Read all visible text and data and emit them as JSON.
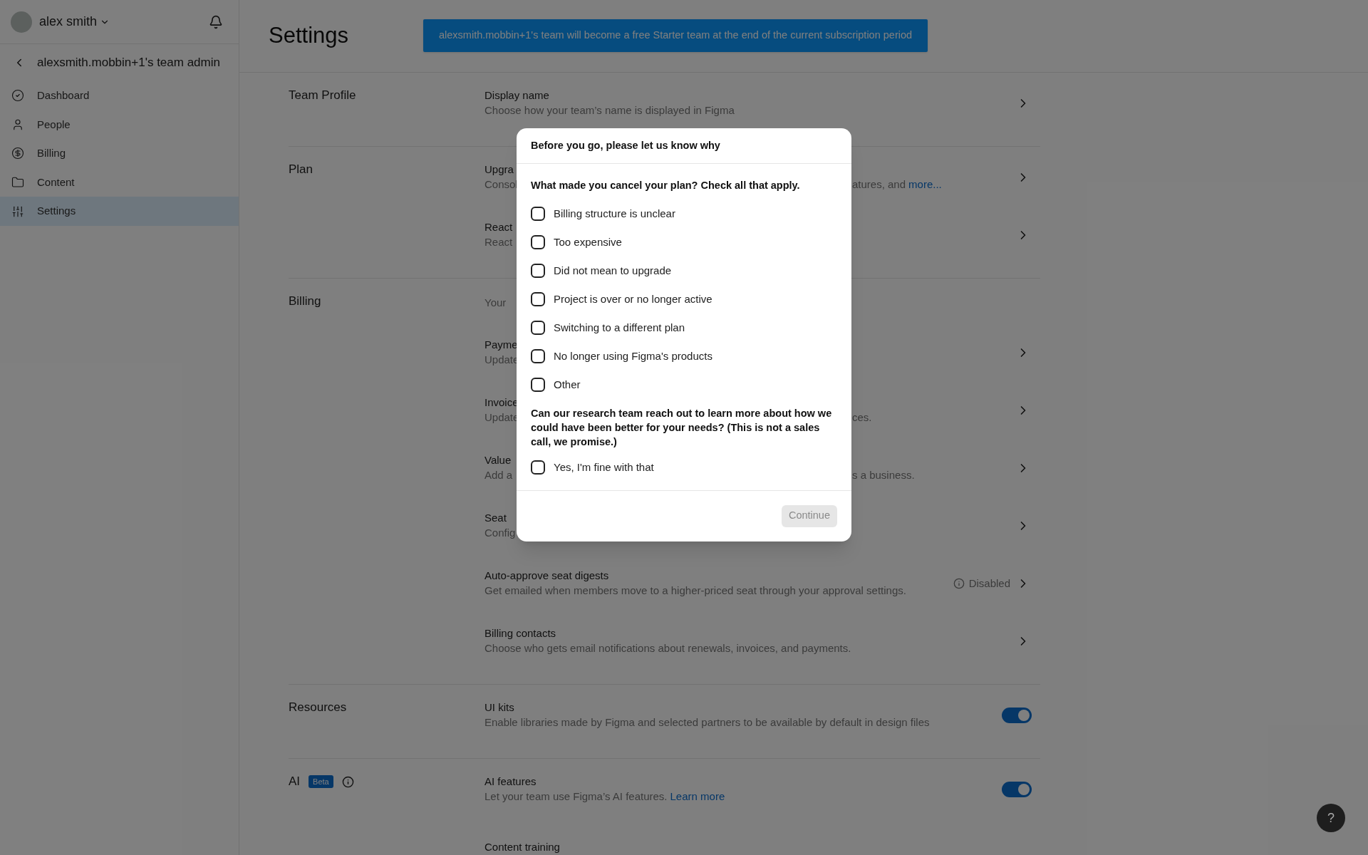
{
  "sidebar": {
    "user": "alex smith",
    "team": "alexsmith.mobbin+1's team admin",
    "items": [
      {
        "label": "Dashboard",
        "selected": false
      },
      {
        "label": "People",
        "selected": false
      },
      {
        "label": "Billing",
        "selected": false
      },
      {
        "label": "Content",
        "selected": false
      },
      {
        "label": "Settings",
        "selected": true
      }
    ]
  },
  "header": {
    "title": "Settings",
    "banner": "alexsmith.mobbin+1's team will become a free Starter team at the end of the current subscription period"
  },
  "sections": [
    {
      "title": "Team Profile",
      "rows": [
        {
          "kind": "chevron",
          "title": "Display name",
          "description": "Choose how your team’s name is displayed in Figma"
        }
      ]
    },
    {
      "title": "Plan",
      "rows": [
        {
          "kind": "chevron",
          "title": "Upgra",
          "description": "Consol",
          "description_right": "atures, and ",
          "link": "more..."
        },
        {
          "kind": "chevron",
          "title": "React",
          "description": "React"
        }
      ]
    },
    {
      "title": "Billing",
      "rows": [
        {
          "kind": "note",
          "description": "Your"
        },
        {
          "kind": "chevron",
          "title": "Payme",
          "description": "Update"
        },
        {
          "kind": "chevron",
          "title": "Invoice",
          "description": "Update",
          "description_right": "ces."
        },
        {
          "kind": "chevron",
          "title": "Value",
          "description": "Add a",
          "description_right": "s a business."
        },
        {
          "kind": "chevron",
          "title": "Seat",
          "description": "Config"
        },
        {
          "kind": "chevron",
          "title": "Auto-approve seat digests",
          "description": "Get emailed when members move to a higher-priced seat through your approval settings.",
          "status": "Disabled"
        },
        {
          "kind": "chevron",
          "title": "Billing contacts",
          "description": "Choose who gets email notifications about renewals, invoices, and payments."
        }
      ]
    },
    {
      "title": "Resources",
      "rows": [
        {
          "kind": "toggle",
          "on": true,
          "title": "UI kits",
          "description": "Enable libraries made by Figma and selected partners to be available by default in design files"
        }
      ]
    },
    {
      "title": "AI",
      "badge": "Beta",
      "rows": [
        {
          "kind": "toggle",
          "on": true,
          "title": "AI features",
          "description": "Let your team use Figma’s AI features. ",
          "link": "Learn more"
        },
        {
          "kind": "none",
          "title": "Content training"
        }
      ]
    }
  ],
  "modal": {
    "title": "Before you go, please let us know why",
    "question": "What made you cancel your plan? Check all that apply.",
    "options": [
      {
        "label": "Billing structure is unclear",
        "checked": false
      },
      {
        "label": "Too expensive",
        "checked": false
      },
      {
        "label": "Did not mean to upgrade",
        "checked": false
      },
      {
        "label": "Project is over or no longer active",
        "checked": false
      },
      {
        "label": "Switching to a different plan",
        "checked": false
      },
      {
        "label": "No longer using Figma's products",
        "checked": false
      },
      {
        "label": "Other",
        "checked": false
      }
    ],
    "research_question": "Can our research team reach out to learn more about how we could have been better for your needs? (This is not a sales call, we promise.)",
    "research_options": [
      {
        "label": "Yes, I'm fine with that",
        "checked": false
      }
    ],
    "continue": {
      "label": "Continue",
      "disabled": true
    }
  },
  "help": "?"
}
